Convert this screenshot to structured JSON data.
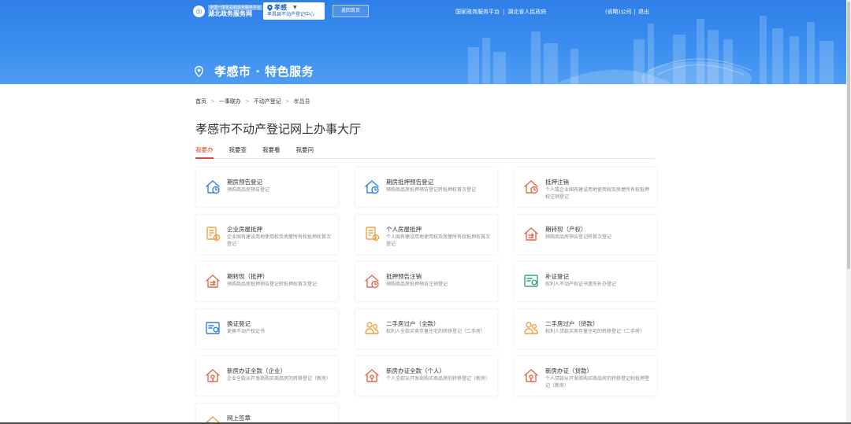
{
  "colors": {
    "banner": "#3b8ef0",
    "accent": "#e34b2c",
    "icon_blue": "#2f7fe6",
    "icon_orange": "#f0a347",
    "icon_red": "#e3694d",
    "icon_green": "#3aa57a"
  },
  "header": {
    "logo_top": "全国一体化在线政务服务平台",
    "logo_main": "湖北政务服务网",
    "city": "孝感",
    "city_sub": "孝昌县不动产登记中心",
    "back_label": "返回首页",
    "links": [
      "国家政务服务平台",
      "湖北省人民政府"
    ],
    "user_name": "(省略)公司",
    "logout": "退出"
  },
  "page_heading": "孝感市 · 特色服务",
  "breadcrumb": [
    "首页",
    "一事联办",
    "不动产登记",
    "孝昌县"
  ],
  "hall_title": "孝感市不动产登记网上办事大厅",
  "tabs": [
    "我要办",
    "我要查",
    "我要看",
    "我要问"
  ],
  "services": [
    {
      "title": "期房预告登记",
      "desc": "预购商品房预告登记",
      "icon": "house-clock-icon",
      "color": "#2f7fe6"
    },
    {
      "title": "期房抵押预告登记",
      "desc": "预购商品房抵押预告登记转抵押权首次登记",
      "icon": "house-clock-icon",
      "color": "#2f7fe6"
    },
    {
      "title": "抵押注销",
      "desc": "个人或企业国有建设用地使用权及房屋所有权抵押权注销登记",
      "icon": "house-clock-icon",
      "color": "#e3694d"
    },
    {
      "title": "企业房屋抵押",
      "desc": "企业国有建设用地使用权及房屋所有权抵押权首次登记",
      "icon": "document-coin-icon",
      "color": "#f0a347"
    },
    {
      "title": "个人房屋抵押",
      "desc": "个人国有建设用地使用权及房屋所有权抵押权首次登记",
      "icon": "document-coin-icon",
      "color": "#f0a347"
    },
    {
      "title": "期转现（产权）",
      "desc": "预购商品房预告登记转首次登记",
      "icon": "house-transfer-icon",
      "color": "#e3694d"
    },
    {
      "title": "期转现（抵押）",
      "desc": "预购商品房抵押预告登记转抵押权首次登记",
      "icon": "house-transfer-icon",
      "color": "#e3694d"
    },
    {
      "title": "抵押预告注销",
      "desc": "预购商品房抵押预告注销登记",
      "icon": "house-clock-icon",
      "color": "#e3694d"
    },
    {
      "title": "补证登记",
      "desc": "权利人不动产权证书遗失补办登记",
      "icon": "certificate-icon",
      "color": "#3aa57a"
    },
    {
      "title": "换证登记",
      "desc": "更换不动产权证书",
      "icon": "certificate-icon",
      "color": "#2f7fe6"
    },
    {
      "title": "二手房过户（全款）",
      "desc": "权利人全款买卖存量住宅的转移登记（二手房）",
      "icon": "people-transfer-icon",
      "color": "#f0a347"
    },
    {
      "title": "二手房过户（贷款）",
      "desc": "权利人贷款买卖存量住宅的转移登记（二手房）",
      "icon": "people-transfer-icon",
      "color": "#f0a347"
    },
    {
      "title": "新房办证全款（企业）",
      "desc": "企业全款从开发商购买商品房的转移登记（新房）",
      "icon": "house-key-icon",
      "color": "#e3694d"
    },
    {
      "title": "新房办证全款（个人）",
      "desc": "个人全款从开发商购买商品房的转移登记（新房）",
      "icon": "house-key-icon",
      "color": "#e3694d"
    },
    {
      "title": "新房办证（贷款）",
      "desc": "个人贷款从开发商购买商品房的转移登记和抵押登记（新房）",
      "icon": "house-key-icon",
      "color": "#e3694d"
    },
    {
      "title": "网上签章",
      "desc": "",
      "icon": "house-clock-icon",
      "color": "#f0a347"
    }
  ]
}
